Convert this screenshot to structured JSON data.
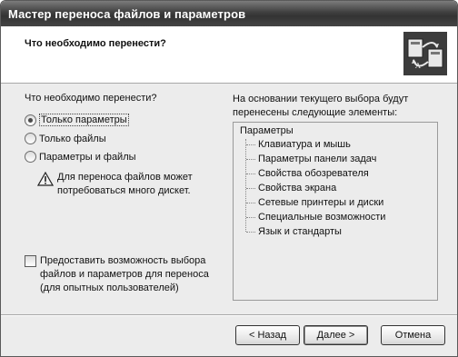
{
  "window": {
    "title": "Мастер переноса файлов и параметров"
  },
  "header": {
    "title": "Что необходимо перенести?",
    "icon": "transfer-wizard-icon"
  },
  "left": {
    "question": "Что необходимо перенести?",
    "options": [
      {
        "label": "Только параметры",
        "checked": true
      },
      {
        "label": "Только файлы",
        "checked": false
      },
      {
        "label": "Параметры и файлы",
        "checked": false
      }
    ],
    "warning": "Для переноса файлов может потребоваться много дискет.",
    "custom_checkbox": {
      "label": "Предоставить возможность выбора файлов и параметров для переноса (для опытных пользователей)",
      "checked": false
    }
  },
  "right": {
    "info": "На основании текущего выбора будут перенесены следующие элементы:",
    "tree_root": "Параметры",
    "tree_items": [
      "Клавиатура и мышь",
      "Параметры панели задач",
      "Свойства обозревателя",
      "Свойства экрана",
      "Сетевые принтеры и диски",
      "Специальные возможности",
      "Язык и стандарты"
    ]
  },
  "buttons": {
    "back": "< Назад",
    "next": "Далее >",
    "cancel": "Отмена"
  }
}
